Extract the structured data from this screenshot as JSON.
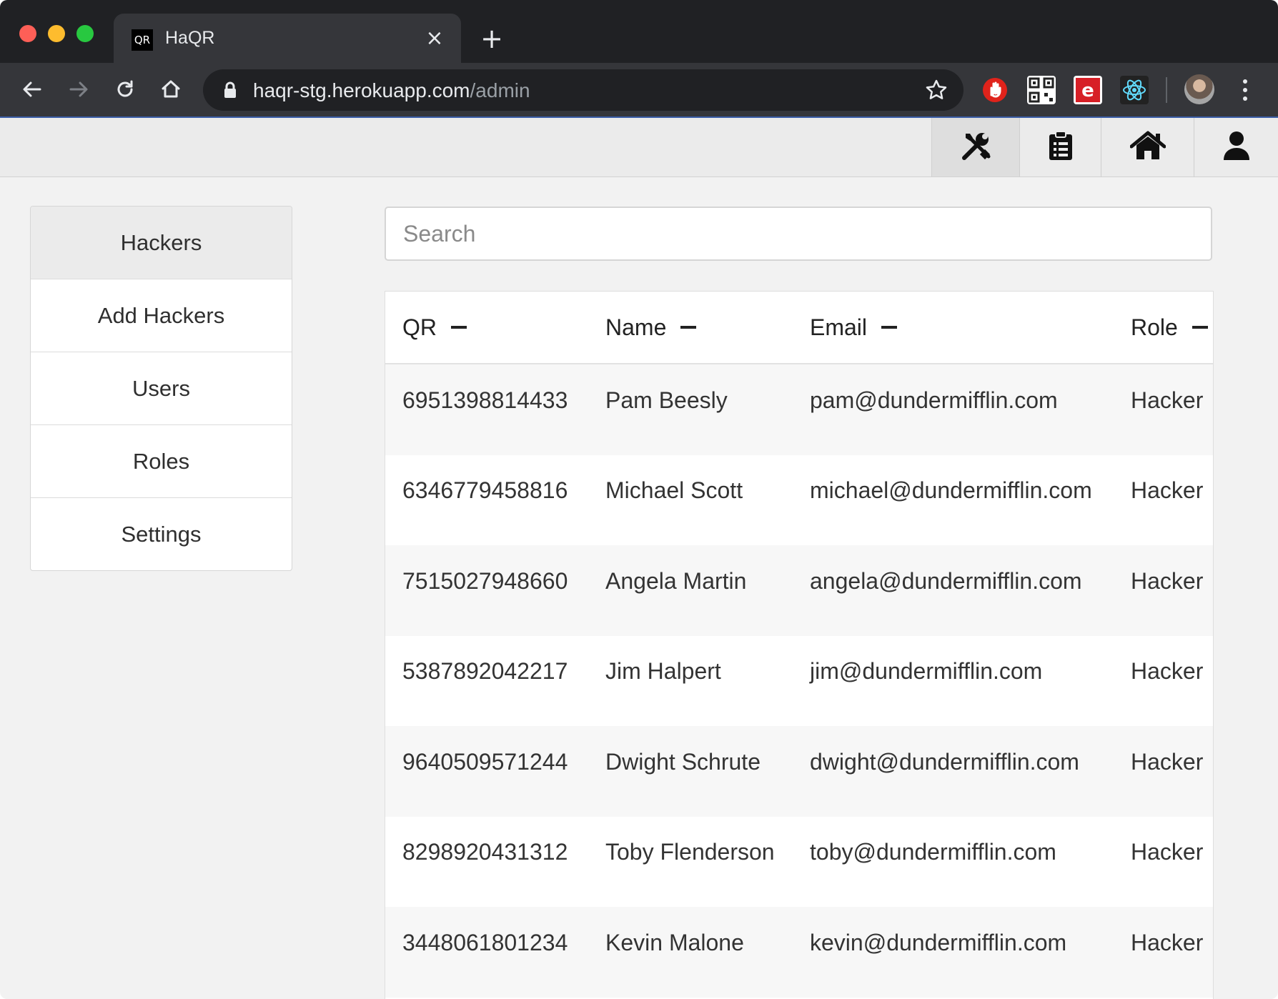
{
  "browser": {
    "tab_title": "HaQR",
    "tab_favicon": "QR",
    "tab_close": "×",
    "new_tab": "+",
    "url_host": "haqr-stg.herokuapp.com",
    "url_path": "/admin",
    "icons": [
      "back-icon",
      "forward-icon",
      "reload-icon",
      "home-icon",
      "lock-icon",
      "star-icon",
      "stop-hand-extension-icon",
      "qr-extension-icon",
      "e-extension-icon",
      "react-devtools-icon",
      "profile-avatar",
      "menu-dots-icon"
    ]
  },
  "navbar": {
    "items": [
      {
        "icon": "tools-icon",
        "active": true
      },
      {
        "icon": "clipboard-list-icon",
        "active": false
      },
      {
        "icon": "home-icon",
        "active": false
      },
      {
        "icon": "user-icon",
        "active": false
      }
    ]
  },
  "sidebar": {
    "items": [
      {
        "label": "Hackers"
      },
      {
        "label": "Add Hackers"
      },
      {
        "label": "Users"
      },
      {
        "label": "Roles"
      },
      {
        "label": "Settings"
      }
    ]
  },
  "search": {
    "placeholder": "Search",
    "value": ""
  },
  "table": {
    "columns": [
      "QR",
      "Name",
      "Email",
      "Role"
    ],
    "rows": [
      {
        "qr": "6951398814433",
        "name": "Pam Beesly",
        "email": "pam@dundermifflin.com",
        "role": "Hacker"
      },
      {
        "qr": "6346779458816",
        "name": "Michael Scott",
        "email": "michael@dundermifflin.com",
        "role": "Hacker"
      },
      {
        "qr": "7515027948660",
        "name": "Angela Martin",
        "email": "angela@dundermifflin.com",
        "role": "Hacker"
      },
      {
        "qr": "5387892042217",
        "name": "Jim Halpert",
        "email": "jim@dundermifflin.com",
        "role": "Hacker"
      },
      {
        "qr": "9640509571244",
        "name": "Dwight Schrute",
        "email": "dwight@dundermifflin.com",
        "role": "Hacker"
      },
      {
        "qr": "8298920431312",
        "name": "Toby Flenderson",
        "email": "toby@dundermifflin.com",
        "role": "Hacker"
      },
      {
        "qr": "3448061801234",
        "name": "Kevin Malone",
        "email": "kevin@dundermifflin.com",
        "role": "Hacker"
      }
    ]
  },
  "colors": {
    "chrome_dark": "#202124",
    "chrome_toolbar": "#35363a",
    "page_bg": "#f2f2f2",
    "navbar_bg": "#ebebeb",
    "row_stripe": "#f7f7f7"
  }
}
